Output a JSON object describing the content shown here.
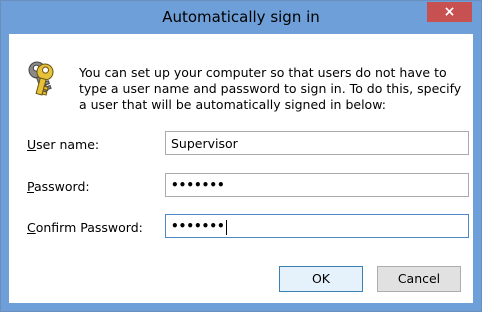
{
  "window": {
    "title": "Automatically sign in",
    "close_glyph": "×"
  },
  "intro_text": "You can set up your computer so that users do not have to type a user name and password to sign in. To do this, specify a user that will be automatically signed in below:",
  "fields": {
    "username": {
      "label_prefix": "U",
      "label_rest": "ser name:",
      "value": "Supervisor"
    },
    "password": {
      "label_prefix": "P",
      "label_rest": "assword:",
      "value": "•••••••"
    },
    "confirm": {
      "label_prefix": "C",
      "label_rest": "onfirm Password:",
      "value": "•••••••"
    }
  },
  "buttons": {
    "ok": "OK",
    "cancel": "Cancel"
  },
  "icon": {
    "name": "keys-icon"
  },
  "colors": {
    "titlebar": "#6f9fd8",
    "close": "#c75050",
    "focus_border": "#4f86c6"
  }
}
